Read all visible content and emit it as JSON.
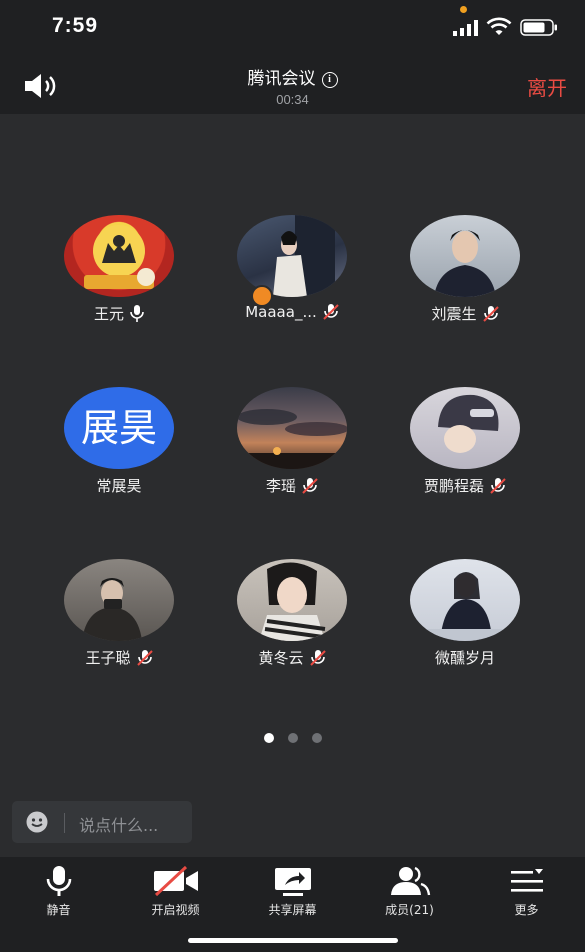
{
  "status_bar": {
    "time": "7:59"
  },
  "header": {
    "title": "腾讯会议",
    "timer": "00:34",
    "leave_label": "离开"
  },
  "participants": [
    {
      "name": "王元",
      "mic": "on",
      "avatar": "photo"
    },
    {
      "name": "Maaaa_...",
      "mic": "muted",
      "avatar": "photo",
      "host": true
    },
    {
      "name": "刘震生",
      "mic": "muted",
      "avatar": "photo"
    },
    {
      "name": "常展昊",
      "mic": "none",
      "avatar_text": "展昊",
      "avatar_color": "#2f6ce8"
    },
    {
      "name": "李瑶",
      "mic": "muted",
      "avatar": "photo"
    },
    {
      "name": "贾鹏程磊",
      "mic": "muted",
      "avatar": "photo"
    },
    {
      "name": "王子聪",
      "mic": "muted",
      "avatar": "photo"
    },
    {
      "name": "黄冬云",
      "mic": "muted",
      "avatar": "photo"
    },
    {
      "name": "微醺岁月",
      "mic": "none",
      "avatar": "photo"
    }
  ],
  "pager": {
    "pages": 3,
    "active": 1
  },
  "chat": {
    "placeholder": "说点什么..."
  },
  "toolbar": {
    "mute_label": "静音",
    "video_label": "开启视频",
    "share_label": "共享屏幕",
    "members_label": "成员(21)",
    "more_label": "更多"
  },
  "colors": {
    "accent_leave": "#e84b43",
    "background": "#2b2c2e",
    "bar": "#1f2022"
  }
}
